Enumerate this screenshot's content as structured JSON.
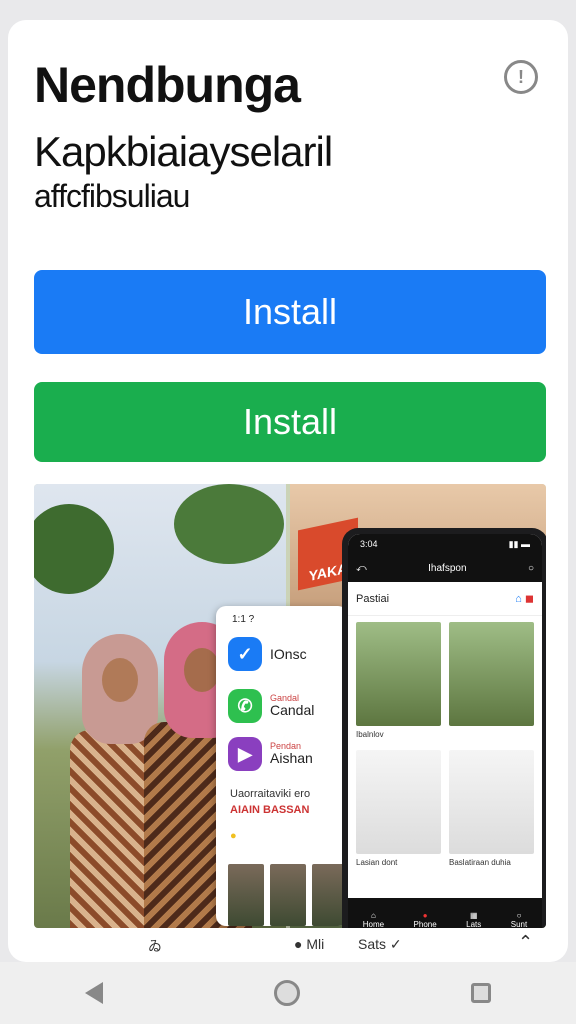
{
  "header": {
    "title": "Nendbunga",
    "subtitle": "Kapkbiaiayselaril",
    "tagline": "affcfibsuliau",
    "info_icon": "info-icon"
  },
  "actions": {
    "install_primary": "Install",
    "install_secondary": "Install"
  },
  "preview": {
    "banner_text": "YAKA",
    "tablet": {
      "time": "1:1 ?",
      "rows": [
        {
          "icon": "check-icon",
          "label": "IOnsc",
          "sub": ""
        },
        {
          "icon": "chat-icon",
          "label": "Candal",
          "sub": "Gandal"
        },
        {
          "icon": "video-icon",
          "label": "Aishan",
          "sub": "Pendan"
        }
      ],
      "line1": "Uaorraitaviki ero",
      "line2": "AIAIN BASSAN"
    },
    "phone": {
      "status_time": "3:04",
      "top_title": "Ihafspon",
      "header_label": "Pastiai",
      "captions": [
        "Ibalnlov",
        "",
        "Lasian dont",
        "Baslatiraan duhia"
      ],
      "nav": [
        "Home",
        "Phone",
        "Lats",
        "Sunt"
      ]
    }
  },
  "footer_caption": {
    "left": "ゐ",
    "middle": "● Mli",
    "right": "Sats  ✓",
    "up": "⌃"
  },
  "colors": {
    "install_blue": "#1a7bf5",
    "install_green": "#1aae4e"
  }
}
